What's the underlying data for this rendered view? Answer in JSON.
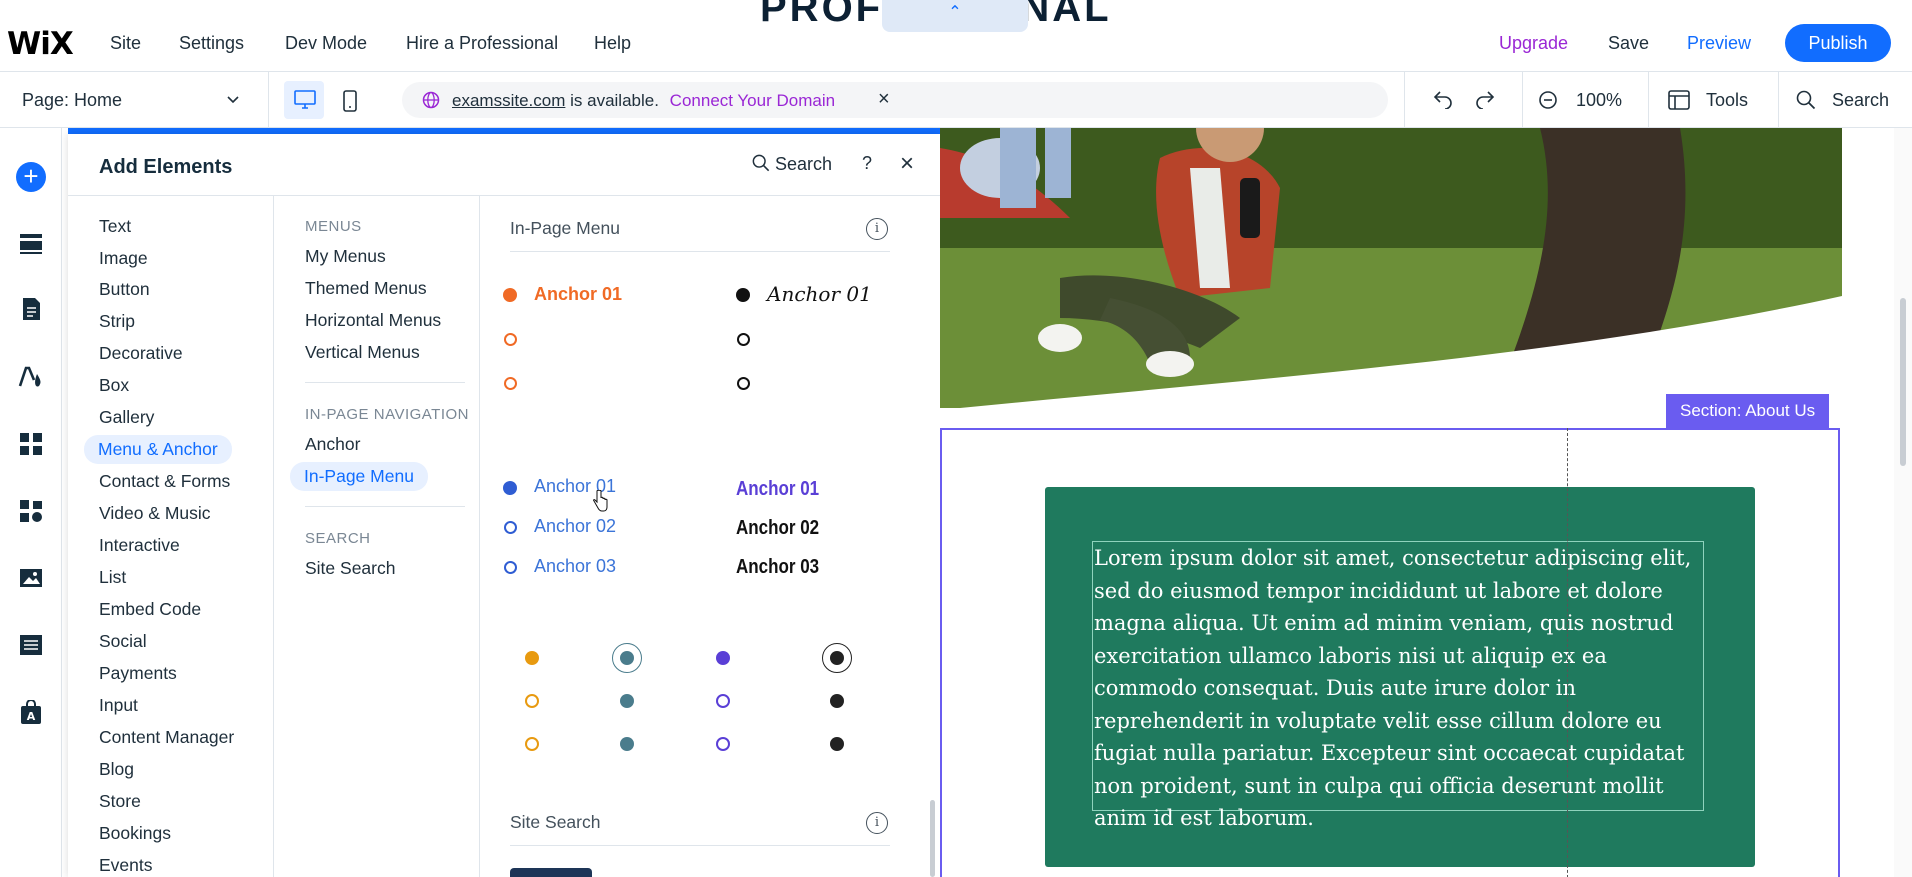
{
  "brand": "WiX",
  "top_nav": [
    "Site",
    "Settings",
    "Dev Mode",
    "Hire a Professional",
    "Help"
  ],
  "top_right": {
    "upgrade": "Upgrade",
    "save": "Save",
    "preview": "Preview",
    "publish": "Publish"
  },
  "page_peek": {
    "text": "PROFESSIONAL",
    "collapse_glyph": "⌃"
  },
  "subbar": {
    "page_selector": "Page: Home",
    "domain": {
      "name": "examssite.com",
      "status": "is available.",
      "connect": "Connect Your Domain"
    },
    "zoom": "100%",
    "tools": "Tools",
    "search": "Search"
  },
  "panel": {
    "title": "Add Elements",
    "search": "Search",
    "help": "?",
    "categories": [
      "Text",
      "Image",
      "Button",
      "Strip",
      "Decorative",
      "Box",
      "Gallery",
      "Menu & Anchor",
      "Contact & Forms",
      "Video & Music",
      "Interactive",
      "List",
      "Embed Code",
      "Social",
      "Payments",
      "Input",
      "Content Manager",
      "Blog",
      "Store",
      "Bookings",
      "Events"
    ],
    "active_category": "Menu & Anchor",
    "subsections": {
      "menus_header": "MENUS",
      "menus": [
        "My Menus",
        "Themed Menus",
        "Horizontal Menus",
        "Vertical Menus"
      ],
      "nav_header": "IN-PAGE NAVIGATION",
      "nav": [
        "Anchor",
        "In-Page Menu"
      ],
      "search_header": "SEARCH",
      "search": [
        "Site Search"
      ]
    },
    "active_subsection": "In-Page Menu",
    "gallery": {
      "section1": "In-Page Menu",
      "presets": {
        "orange_label": "Anchor 01",
        "script_label": "Anchor 01",
        "blue_labels": [
          "Anchor 01",
          "Anchor 02",
          "Anchor 03"
        ],
        "bold_labels": [
          "Anchor 01",
          "Anchor 02",
          "Anchor 03"
        ]
      },
      "section2": "Site Search"
    }
  },
  "canvas": {
    "section_tag": "Section: About Us",
    "body_text": "Lorem ipsum dolor sit amet, consectetur adipiscing elit, sed do eiusmod tempor incididunt ut labore et dolore magna aliqua. Ut enim ad minim veniam, quis nostrud exercitation ullamco laboris nisi ut aliquip ex ea commodo consequat. Duis aute irure dolor in reprehenderit in voluptate velit esse cillum dolore eu fugiat nulla pariatur. Excepteur sint occaecat cupidatat non proident, sunt in culpa qui officia deserunt mollit anim id est laborum."
  },
  "colors": {
    "accent": "#116dff",
    "upgrade": "#9a27d5",
    "section_outline": "#6a5cf0",
    "about_box": "#1f7a5e",
    "anchor_orange": "#f06a25"
  }
}
